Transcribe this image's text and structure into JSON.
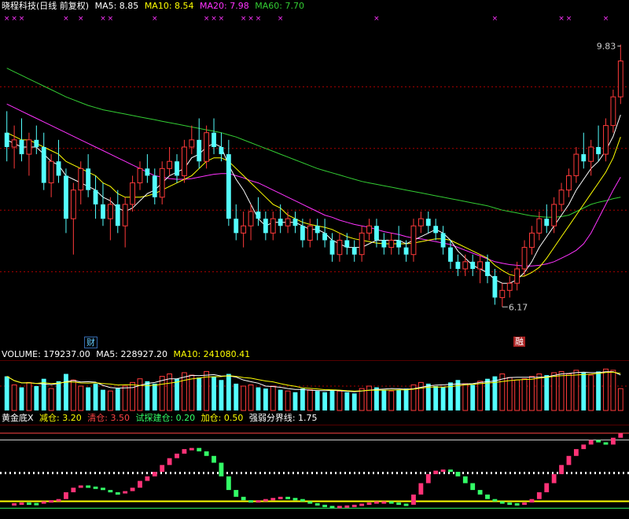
{
  "header": {
    "security_name": "晓程科技(日线 前复权)",
    "ma5_label": "MA5: 8.85",
    "ma10_label": "MA10: 8.54",
    "ma20_label": "MA20: 7.98",
    "ma60_label": "MA60: 7.70"
  },
  "volume_header": {
    "volume_label": "VOLUME: 179237.00",
    "ma5_label": "MA5: 228927.20",
    "ma10_label": "MA10: 241080.41"
  },
  "indicator_header": {
    "name": "黄金底X",
    "item1": "减仓: 3.20",
    "item2": "清仓: 3.50",
    "item3": "试探建仓: 0.20",
    "item4": "加仓: 0.50",
    "item5": "强弱分界线: 1.75"
  },
  "markers": {
    "finance_tag": "财",
    "event_tag": "融"
  },
  "colors": {
    "up": "#ff3a3a",
    "down": "#54ffff",
    "ma5": "#ffffff",
    "ma10": "#ffff00",
    "ma20": "#ff33ff",
    "ma60": "#33cc33",
    "grid": "#aa0000",
    "osc_up": "#ff3377",
    "osc_down": "#33ff66"
  },
  "chart_data": [
    {
      "type": "candlestick",
      "title": "晓程科技(日线 前复权)",
      "ylim": [
        5.8,
        10.1
      ],
      "high_label": "9.83",
      "low_label": "6.17",
      "ohlc": [
        [
          8.6,
          8.9,
          8.2,
          8.4
        ],
        [
          8.4,
          8.7,
          8.1,
          8.5
        ],
        [
          8.5,
          8.8,
          8.2,
          8.3
        ],
        [
          8.3,
          8.6,
          8.0,
          8.5
        ],
        [
          8.5,
          8.7,
          8.3,
          8.4
        ],
        [
          8.4,
          8.6,
          7.8,
          7.9
        ],
        [
          7.9,
          8.3,
          7.7,
          8.2
        ],
        [
          8.2,
          8.5,
          7.9,
          8.0
        ],
        [
          8.0,
          8.1,
          7.2,
          7.4
        ],
        [
          7.4,
          7.9,
          6.9,
          7.8
        ],
        [
          7.8,
          8.2,
          7.6,
          8.1
        ],
        [
          8.1,
          8.3,
          7.7,
          7.8
        ],
        [
          7.8,
          8.0,
          7.4,
          7.6
        ],
        [
          7.6,
          7.9,
          7.3,
          7.4
        ],
        [
          7.4,
          7.7,
          7.1,
          7.6
        ],
        [
          7.6,
          7.8,
          7.2,
          7.3
        ],
        [
          7.3,
          7.7,
          7.0,
          7.6
        ],
        [
          7.6,
          8.0,
          7.5,
          7.9
        ],
        [
          7.9,
          8.2,
          7.8,
          8.1
        ],
        [
          8.1,
          8.3,
          7.9,
          8.0
        ],
        [
          8.0,
          8.1,
          7.6,
          7.7
        ],
        [
          7.7,
          8.2,
          7.6,
          8.1
        ],
        [
          8.1,
          8.4,
          8.0,
          8.2
        ],
        [
          8.2,
          8.3,
          7.9,
          8.0
        ],
        [
          8.0,
          8.5,
          7.9,
          8.4
        ],
        [
          8.4,
          8.7,
          8.3,
          8.5
        ],
        [
          8.5,
          8.8,
          8.1,
          8.2
        ],
        [
          8.2,
          8.7,
          8.1,
          8.6
        ],
        [
          8.6,
          8.8,
          8.3,
          8.4
        ],
        [
          8.4,
          8.6,
          8.2,
          8.3
        ],
        [
          8.3,
          8.5,
          7.3,
          7.4
        ],
        [
          7.4,
          7.6,
          7.1,
          7.2
        ],
        [
          7.2,
          7.5,
          7.0,
          7.3
        ],
        [
          7.3,
          7.6,
          7.1,
          7.5
        ],
        [
          7.5,
          7.7,
          7.3,
          7.4
        ],
        [
          7.4,
          7.5,
          7.1,
          7.2
        ],
        [
          7.2,
          7.5,
          7.1,
          7.4
        ],
        [
          7.4,
          7.6,
          7.2,
          7.3
        ],
        [
          7.3,
          7.5,
          7.2,
          7.4
        ],
        [
          7.4,
          7.5,
          7.2,
          7.3
        ],
        [
          7.3,
          7.4,
          7.0,
          7.1
        ],
        [
          7.1,
          7.4,
          7.0,
          7.3
        ],
        [
          7.3,
          7.4,
          7.1,
          7.2
        ],
        [
          7.2,
          7.4,
          7.0,
          7.1
        ],
        [
          7.1,
          7.2,
          6.8,
          6.9
        ],
        [
          6.9,
          7.2,
          6.8,
          7.1
        ],
        [
          7.1,
          7.2,
          6.9,
          7.0
        ],
        [
          7.0,
          7.1,
          6.8,
          6.9
        ],
        [
          6.9,
          7.3,
          6.8,
          7.2
        ],
        [
          7.2,
          7.4,
          7.1,
          7.3
        ],
        [
          7.3,
          7.4,
          7.0,
          7.1
        ],
        [
          7.1,
          7.2,
          6.9,
          7.0
        ],
        [
          7.0,
          7.2,
          6.9,
          7.1
        ],
        [
          7.1,
          7.3,
          6.9,
          7.0
        ],
        [
          7.0,
          7.1,
          6.8,
          6.9
        ],
        [
          6.9,
          7.4,
          6.8,
          7.3
        ],
        [
          7.3,
          7.5,
          7.2,
          7.4
        ],
        [
          7.4,
          7.5,
          7.2,
          7.3
        ],
        [
          7.3,
          7.4,
          7.1,
          7.2
        ],
        [
          7.2,
          7.3,
          6.9,
          7.0
        ],
        [
          7.0,
          7.1,
          6.7,
          6.8
        ],
        [
          6.8,
          6.9,
          6.6,
          6.7
        ],
        [
          6.7,
          6.9,
          6.6,
          6.8
        ],
        [
          6.8,
          6.9,
          6.6,
          6.7
        ],
        [
          6.7,
          6.9,
          6.5,
          6.8
        ],
        [
          6.8,
          6.9,
          6.5,
          6.6
        ],
        [
          6.6,
          6.7,
          6.2,
          6.3
        ],
        [
          6.3,
          6.5,
          6.17,
          6.4
        ],
        [
          6.4,
          6.6,
          6.3,
          6.5
        ],
        [
          6.5,
          6.8,
          6.4,
          6.7
        ],
        [
          6.7,
          7.1,
          6.6,
          7.0
        ],
        [
          7.0,
          7.3,
          6.9,
          7.2
        ],
        [
          7.2,
          7.5,
          7.1,
          7.4
        ],
        [
          7.4,
          7.6,
          7.2,
          7.3
        ],
        [
          7.3,
          7.7,
          7.2,
          7.6
        ],
        [
          7.6,
          7.9,
          7.5,
          7.8
        ],
        [
          7.8,
          8.1,
          7.7,
          8.0
        ],
        [
          8.0,
          8.4,
          7.9,
          8.3
        ],
        [
          8.3,
          8.6,
          8.1,
          8.2
        ],
        [
          8.2,
          8.5,
          8.0,
          8.4
        ],
        [
          8.4,
          8.7,
          8.2,
          8.3
        ],
        [
          8.3,
          8.8,
          8.2,
          8.7
        ],
        [
          8.7,
          9.2,
          8.6,
          9.1
        ],
        [
          9.1,
          9.83,
          9.0,
          9.6
        ]
      ],
      "ma5": [
        8.5,
        8.45,
        8.4,
        8.4,
        8.4,
        8.3,
        8.2,
        8.15,
        8.0,
        7.95,
        7.9,
        7.85,
        7.8,
        7.7,
        7.65,
        7.55,
        7.5,
        7.55,
        7.65,
        7.75,
        7.8,
        7.9,
        8.0,
        8.05,
        8.1,
        8.25,
        8.3,
        8.4,
        8.45,
        8.4,
        8.15,
        7.95,
        7.8,
        7.6,
        7.4,
        7.3,
        7.35,
        7.35,
        7.35,
        7.35,
        7.3,
        7.25,
        7.25,
        7.2,
        7.1,
        7.05,
        7.0,
        7.0,
        7.0,
        7.05,
        7.1,
        7.1,
        7.1,
        7.1,
        7.05,
        7.1,
        7.15,
        7.2,
        7.25,
        7.2,
        7.1,
        6.95,
        6.85,
        6.75,
        6.7,
        6.65,
        6.55,
        6.5,
        6.5,
        6.55,
        6.65,
        6.8,
        7.0,
        7.15,
        7.3,
        7.45,
        7.6,
        7.8,
        7.95,
        8.1,
        8.2,
        8.35,
        8.55,
        8.85
      ],
      "ma10": [
        8.6,
        8.55,
        8.5,
        8.5,
        8.45,
        8.4,
        8.35,
        8.3,
        8.2,
        8.15,
        8.1,
        8.05,
        8.0,
        7.9,
        7.85,
        7.75,
        7.7,
        7.7,
        7.7,
        7.72,
        7.75,
        7.8,
        7.85,
        7.9,
        7.95,
        8.0,
        8.1,
        8.2,
        8.25,
        8.25,
        8.2,
        8.1,
        8.0,
        7.9,
        7.8,
        7.7,
        7.6,
        7.55,
        7.45,
        7.4,
        7.35,
        7.32,
        7.3,
        7.28,
        7.25,
        7.2,
        7.15,
        7.12,
        7.1,
        7.08,
        7.06,
        7.05,
        7.05,
        7.05,
        7.05,
        7.06,
        7.08,
        7.1,
        7.12,
        7.12,
        7.1,
        7.05,
        7.0,
        6.95,
        6.9,
        6.85,
        6.75,
        6.68,
        6.62,
        6.6,
        6.6,
        6.65,
        6.72,
        6.85,
        7.0,
        7.15,
        7.3,
        7.45,
        7.6,
        7.75,
        7.9,
        8.05,
        8.25,
        8.54
      ],
      "ma20": [
        9.0,
        8.95,
        8.9,
        8.85,
        8.8,
        8.75,
        8.7,
        8.65,
        8.6,
        8.55,
        8.5,
        8.45,
        8.4,
        8.35,
        8.3,
        8.25,
        8.2,
        8.15,
        8.1,
        8.05,
        8.0,
        7.98,
        7.96,
        7.95,
        7.95,
        7.96,
        7.98,
        8.0,
        8.02,
        8.03,
        8.03,
        8.0,
        7.97,
        7.93,
        7.9,
        7.85,
        7.8,
        7.75,
        7.7,
        7.65,
        7.6,
        7.55,
        7.5,
        7.45,
        7.42,
        7.38,
        7.35,
        7.32,
        7.3,
        7.28,
        7.25,
        7.22,
        7.2,
        7.18,
        7.15,
        7.13,
        7.12,
        7.1,
        7.08,
        7.06,
        7.04,
        7.0,
        6.96,
        6.92,
        6.88,
        6.84,
        6.8,
        6.78,
        6.76,
        6.75,
        6.74,
        6.74,
        6.75,
        6.77,
        6.8,
        6.85,
        6.9,
        6.96,
        7.05,
        7.2,
        7.4,
        7.6,
        7.8,
        7.98
      ],
      "ma60": [
        9.5,
        9.45,
        9.4,
        9.35,
        9.3,
        9.25,
        9.2,
        9.15,
        9.1,
        9.06,
        9.02,
        8.98,
        8.95,
        8.92,
        8.9,
        8.88,
        8.86,
        8.84,
        8.82,
        8.8,
        8.78,
        8.76,
        8.74,
        8.72,
        8.7,
        8.68,
        8.66,
        8.64,
        8.62,
        8.6,
        8.57,
        8.54,
        8.5,
        8.46,
        8.42,
        8.38,
        8.34,
        8.3,
        8.26,
        8.22,
        8.18,
        8.14,
        8.1,
        8.07,
        8.04,
        8.01,
        7.98,
        7.95,
        7.92,
        7.9,
        7.88,
        7.86,
        7.84,
        7.82,
        7.8,
        7.78,
        7.76,
        7.74,
        7.72,
        7.7,
        7.68,
        7.66,
        7.64,
        7.62,
        7.6,
        7.58,
        7.55,
        7.52,
        7.5,
        7.48,
        7.46,
        7.44,
        7.43,
        7.42,
        7.42,
        7.43,
        7.45,
        7.5,
        7.55,
        7.6,
        7.63,
        7.65,
        7.68,
        7.7
      ]
    },
    {
      "type": "bar",
      "title": "VOLUME: 179237.00",
      "ylim": [
        0,
        400000
      ],
      "values": [
        280000,
        210000,
        190000,
        230000,
        200000,
        260000,
        180000,
        240000,
        300000,
        250000,
        200000,
        190000,
        220000,
        170000,
        160000,
        180000,
        200000,
        230000,
        260000,
        240000,
        220000,
        280000,
        300000,
        260000,
        310000,
        290000,
        270000,
        320000,
        280000,
        250000,
        300000,
        220000,
        200000,
        210000,
        190000,
        180000,
        200000,
        170000,
        160000,
        150000,
        180000,
        170000,
        160000,
        150000,
        170000,
        160000,
        150000,
        140000,
        180000,
        200000,
        190000,
        170000,
        160000,
        170000,
        180000,
        210000,
        230000,
        220000,
        200000,
        190000,
        230000,
        250000,
        220000,
        210000,
        240000,
        260000,
        280000,
        300000,
        270000,
        250000,
        260000,
        280000,
        300000,
        290000,
        310000,
        320000,
        300000,
        330000,
        310000,
        290000,
        320000,
        340000,
        330000,
        179237
      ]
    },
    {
      "type": "line",
      "title": "黄金底X",
      "ylim": [
        0,
        3.6
      ],
      "reference_lines": [
        3.2,
        3.5,
        0.2,
        0.5,
        1.75
      ],
      "values": [
        0.4,
        0.42,
        0.45,
        0.43,
        0.4,
        0.5,
        0.55,
        0.6,
        0.9,
        1.1,
        1.2,
        1.15,
        1.1,
        1.0,
        0.9,
        0.85,
        0.95,
        1.1,
        1.4,
        1.6,
        1.8,
        2.1,
        2.4,
        2.6,
        2.8,
        2.85,
        2.7,
        2.5,
        2.2,
        1.6,
        1.0,
        0.7,
        0.55,
        0.5,
        0.55,
        0.6,
        0.65,
        0.7,
        0.65,
        0.6,
        0.5,
        0.42,
        0.35,
        0.3,
        0.28,
        0.3,
        0.32,
        0.35,
        0.4,
        0.45,
        0.5,
        0.5,
        0.45,
        0.4,
        0.35,
        0.8,
        1.3,
        1.7,
        1.85,
        1.9,
        1.8,
        1.6,
        1.3,
        1.0,
        0.8,
        0.6,
        0.5,
        0.45,
        0.42,
        0.4,
        0.45,
        0.6,
        0.9,
        1.3,
        1.7,
        2.1,
        2.5,
        2.8,
        3.0,
        3.2,
        3.1,
        3.0,
        3.3,
        3.5
      ]
    }
  ]
}
